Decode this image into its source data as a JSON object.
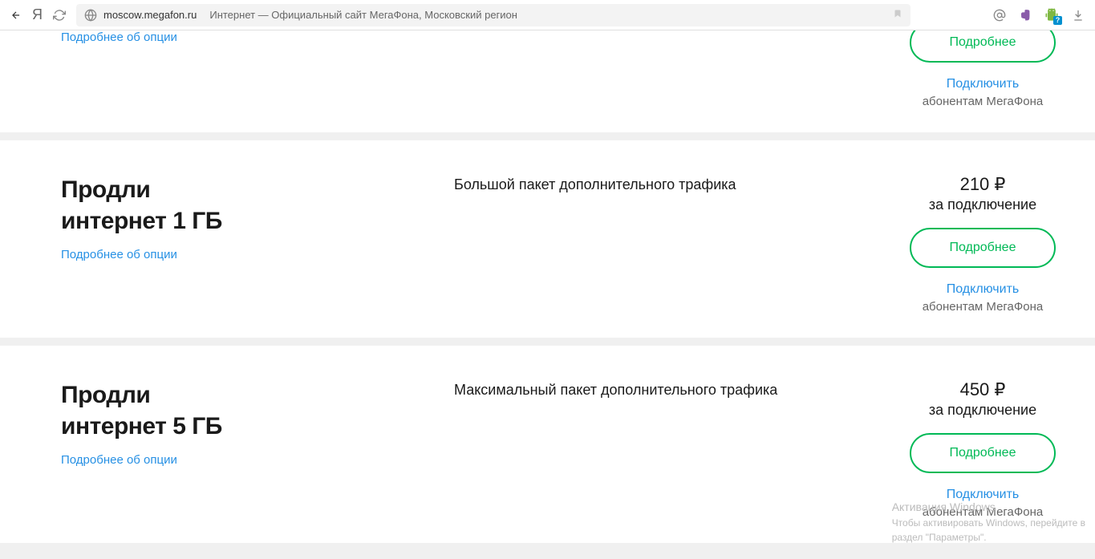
{
  "browser": {
    "url": "moscow.megafon.ru",
    "title": "Интернет — Официальный сайт МегаФона, Московский регион",
    "yandex_letter": "Я"
  },
  "card_partial": {
    "more_link": "Подробнее об опции",
    "btn": "Подробнее",
    "connect": "Подключить",
    "connect_sub": "абонентам МегаФона"
  },
  "cards": [
    {
      "title_l1": "Продли",
      "title_l2": "интернет 1 ГБ",
      "more_link": "Подробнее об опции",
      "desc": "Большой пакет дополнительного трафика",
      "price": "210 ₽",
      "price_sub": "за подключение",
      "btn": "Подробнее",
      "connect": "Подключить",
      "connect_sub": "абонентам МегаФона"
    },
    {
      "title_l1": "Продли",
      "title_l2": "интернет 5 ГБ",
      "more_link": "Подробнее об опции",
      "desc": "Максимальный пакет дополнительного трафика",
      "price": "450 ₽",
      "price_sub": "за подключение",
      "btn": "Подробнее",
      "connect": "Подключить",
      "connect_sub": "абонентам МегаФона"
    }
  ],
  "watermark": {
    "title": "Активация Windows",
    "line1": "Чтобы активировать Windows, перейдите в",
    "line2": "раздел \"Параметры\"."
  },
  "badge": "?"
}
